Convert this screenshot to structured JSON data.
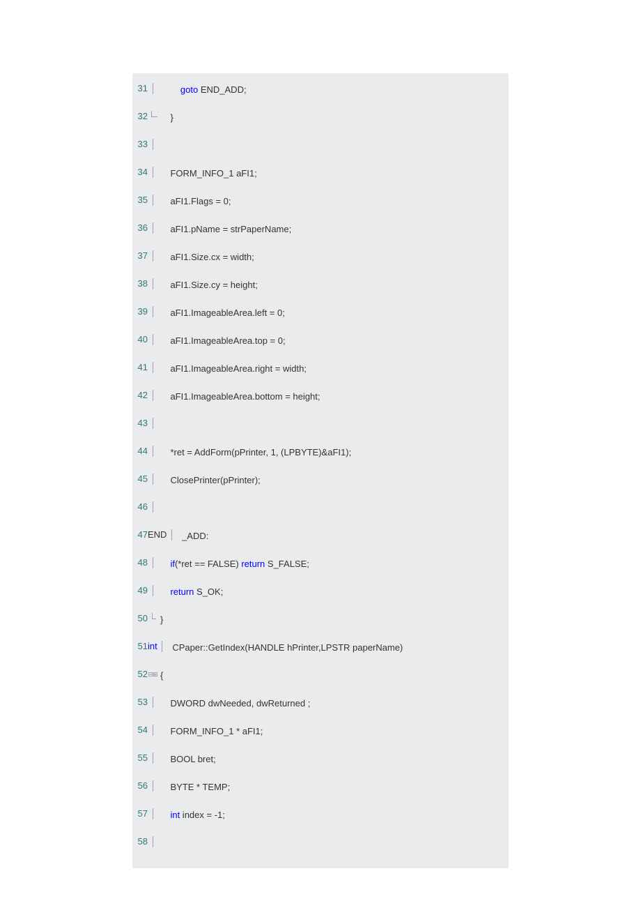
{
  "lines": [
    {
      "num": 31,
      "gutter": "bar",
      "indent": "        ",
      "tokens": [
        {
          "t": "goto",
          "c": "kw"
        },
        {
          "t": " END_ADD;",
          "c": ""
        }
      ]
    },
    {
      "num": 32,
      "gutter": "bar-end",
      "indent": "    ",
      "tokens": [
        {
          "t": "}",
          "c": ""
        }
      ]
    },
    {
      "num": 33,
      "gutter": "bar",
      "indent": "",
      "tokens": []
    },
    {
      "num": 34,
      "gutter": "bar",
      "indent": "    ",
      "tokens": [
        {
          "t": "FORM_INFO_1 aFI1;",
          "c": ""
        }
      ]
    },
    {
      "num": 35,
      "gutter": "bar",
      "indent": "    ",
      "tokens": [
        {
          "t": "aFI1.Flags = 0;",
          "c": ""
        }
      ]
    },
    {
      "num": 36,
      "gutter": "bar",
      "indent": "    ",
      "tokens": [
        {
          "t": "aFI1.pName = strPaperName;",
          "c": ""
        }
      ]
    },
    {
      "num": 37,
      "gutter": "bar",
      "indent": "    ",
      "tokens": [
        {
          "t": "aFI1.Size.cx = width;",
          "c": ""
        }
      ]
    },
    {
      "num": 38,
      "gutter": "bar",
      "indent": "    ",
      "tokens": [
        {
          "t": "aFI1.Size.cy = height;",
          "c": ""
        }
      ]
    },
    {
      "num": 39,
      "gutter": "bar",
      "indent": "    ",
      "tokens": [
        {
          "t": "aFI1.ImageableArea.left = 0;",
          "c": ""
        }
      ]
    },
    {
      "num": 40,
      "gutter": "bar",
      "indent": "    ",
      "tokens": [
        {
          "t": "aFI1.ImageableArea.top = 0;",
          "c": ""
        }
      ]
    },
    {
      "num": 41,
      "gutter": "bar",
      "indent": "    ",
      "tokens": [
        {
          "t": "aFI1.ImageableArea.right = width;",
          "c": ""
        }
      ]
    },
    {
      "num": 42,
      "gutter": "bar",
      "indent": "    ",
      "tokens": [
        {
          "t": "aFI1.ImageableArea.bottom = height;",
          "c": ""
        }
      ]
    },
    {
      "num": 43,
      "gutter": "bar",
      "indent": "",
      "tokens": []
    },
    {
      "num": 44,
      "gutter": "bar",
      "indent": "    ",
      "tokens": [
        {
          "t": "*ret = AddForm(pPrinter, 1, (LPBYTE)&aFI1);",
          "c": ""
        }
      ]
    },
    {
      "num": 45,
      "gutter": "bar",
      "indent": "    ",
      "tokens": [
        {
          "t": "ClosePrinter(pPrinter);",
          "c": ""
        }
      ]
    },
    {
      "num": 46,
      "gutter": "bar",
      "indent": "",
      "tokens": []
    },
    {
      "num": 47,
      "gutter": "none",
      "prefix": "END",
      "indent": "",
      "afterbar": "bar",
      "tokens": [
        {
          "t": " _ADD:",
          "c": ""
        }
      ]
    },
    {
      "num": 48,
      "gutter": "bar",
      "indent": "    ",
      "tokens": [
        {
          "t": "if",
          "c": "kw"
        },
        {
          "t": "(*ret == FALSE) ",
          "c": ""
        },
        {
          "t": "return",
          "c": "kw"
        },
        {
          "t": " S_FALSE;",
          "c": ""
        }
      ]
    },
    {
      "num": 49,
      "gutter": "bar",
      "indent": "    ",
      "tokens": [
        {
          "t": "return",
          "c": "kw"
        },
        {
          "t": " S_OK;",
          "c": ""
        }
      ]
    },
    {
      "num": 50,
      "gutter": "bar-end-short",
      "indent": "",
      "tokens": [
        {
          "t": "}",
          "c": ""
        }
      ]
    },
    {
      "num": 51,
      "gutter": "none",
      "prefix": "int",
      "prefixclass": "ty",
      "indent": "",
      "afterbar": "bar",
      "tokens": [
        {
          "t": " CPaper::GetIndex(HANDLE hPrinter,LPSTR paperName)",
          "c": ""
        }
      ]
    },
    {
      "num": 52,
      "gutter": "fold",
      "indent": "",
      "tokens": [
        {
          "t": "{",
          "c": ""
        }
      ]
    },
    {
      "num": 53,
      "gutter": "bar",
      "indent": "    ",
      "tokens": [
        {
          "t": "DWORD dwNeeded, dwReturned ;",
          "c": ""
        }
      ]
    },
    {
      "num": 54,
      "gutter": "bar",
      "indent": "    ",
      "tokens": [
        {
          "t": "FORM_INFO_1 * aFI1;",
          "c": ""
        }
      ]
    },
    {
      "num": 55,
      "gutter": "bar",
      "indent": "    ",
      "tokens": [
        {
          "t": "BOOL bret;",
          "c": ""
        }
      ]
    },
    {
      "num": 56,
      "gutter": "bar",
      "indent": "    ",
      "tokens": [
        {
          "t": "BYTE * TEMP;",
          "c": ""
        }
      ]
    },
    {
      "num": 57,
      "gutter": "bar",
      "indent": "    ",
      "tokens": [
        {
          "t": "int",
          "c": "ty"
        },
        {
          "t": " index = -1;",
          "c": ""
        }
      ]
    },
    {
      "num": 58,
      "gutter": "bar",
      "indent": "",
      "tokens": []
    }
  ]
}
